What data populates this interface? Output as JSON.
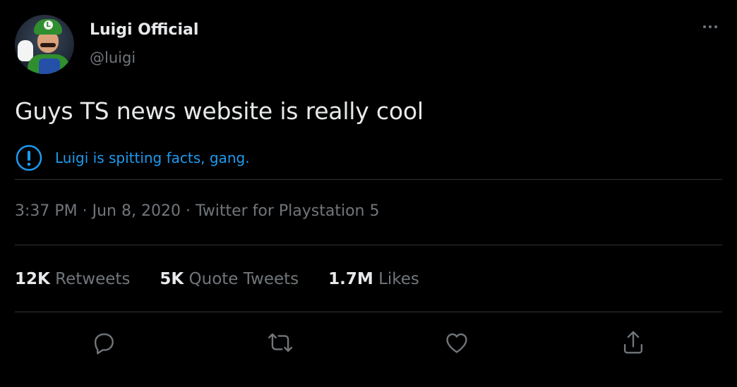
{
  "tweet": {
    "author_name": "Luigi Official",
    "author_handle": "@luigi",
    "avatar_badge": "L",
    "text": "Guys TS news website is really cool",
    "notice": "Luigi is spitting facts, gang.",
    "timestamp": "3:37 PM · Jun 8, 2020 · Twitter for Playstation 5"
  },
  "stats": [
    {
      "count": "12K",
      "label": "Retweets"
    },
    {
      "count": "5K",
      "label": "Quote Tweets"
    },
    {
      "count": "1.7M",
      "label": "Likes"
    }
  ],
  "actions": [
    "reply-icon",
    "retweet-icon",
    "like-icon",
    "share-icon"
  ],
  "colors": {
    "background": "#000000",
    "text_primary": "#e7e9ea",
    "text_secondary": "#71767b",
    "accent": "#1d9bf0",
    "divider": "#2f3336"
  }
}
